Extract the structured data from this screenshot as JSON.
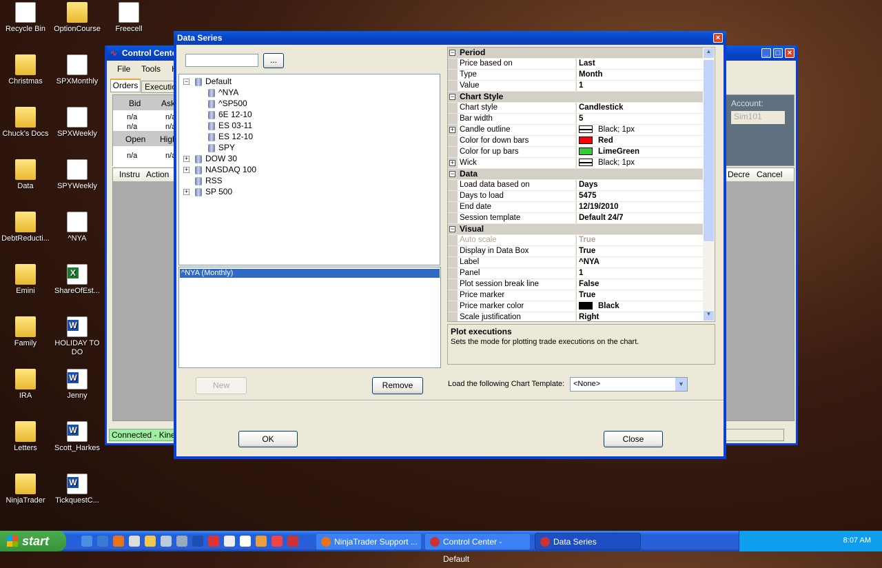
{
  "desktop": {
    "icons": [
      {
        "label": "Recycle Bin",
        "type": "recycle"
      },
      {
        "label": "OptionCourse",
        "type": "folder"
      },
      {
        "label": "Freecell",
        "type": "app"
      },
      {
        "label": "Christmas",
        "type": "folder"
      },
      {
        "label": "SPXMonthly",
        "type": "doc"
      },
      {
        "label": "Chuck's Docs",
        "type": "folder"
      },
      {
        "label": "SPXWeekly",
        "type": "doc"
      },
      {
        "label": "Data",
        "type": "folder"
      },
      {
        "label": "SPYWeekly",
        "type": "doc"
      },
      {
        "label": "DebtReducti...",
        "type": "folder"
      },
      {
        "label": "^NYA",
        "type": "doc"
      },
      {
        "label": "Emini",
        "type": "folder"
      },
      {
        "label": "ShareOfEst...",
        "type": "excel"
      },
      {
        "label": "Family",
        "type": "folder"
      },
      {
        "label": "HOLIDAY TO DO",
        "type": "word"
      },
      {
        "label": "IRA",
        "type": "folder"
      },
      {
        "label": "Jenny",
        "type": "word"
      },
      {
        "label": "Letters",
        "type": "folder"
      },
      {
        "label": "Scott_Harkes",
        "type": "word"
      },
      {
        "label": "NinjaTrader",
        "type": "folder"
      },
      {
        "label": "TickquestC...",
        "type": "word"
      }
    ]
  },
  "control_center": {
    "title": "Control Center",
    "menu": [
      "File",
      "Tools",
      "H"
    ],
    "tabs": [
      "Orders",
      "Execution"
    ],
    "quote_headers": [
      "Bid",
      "Ask"
    ],
    "quote_rows": [
      [
        "n/a",
        "n/a"
      ],
      [
        "n/a",
        "n/a"
      ]
    ],
    "ohlc_headers": [
      "Open",
      "High"
    ],
    "ohlc_row": [
      "n/a",
      "n/a"
    ],
    "account_label": "Account:",
    "account_value": "Sim101",
    "grid_headers": [
      "Instru",
      "Action"
    ],
    "grid_headers_right": [
      "Decre",
      "Cancel"
    ],
    "status": "Connected - Kinetic"
  },
  "dialog": {
    "title": "Data Series",
    "search_value": "",
    "browse_label": "...",
    "tree": [
      {
        "label": "Default",
        "expanded": true,
        "children": [
          "^NYA",
          "^SP500",
          "6E 12-10",
          "ES 03-11",
          "ES 12-10",
          "SPY"
        ]
      },
      {
        "label": "DOW 30",
        "expanded": false
      },
      {
        "label": "NASDAQ 100",
        "expanded": false
      },
      {
        "label": "RSS",
        "expanded": null
      },
      {
        "label": "SP 500",
        "expanded": false
      }
    ],
    "selected_series": [
      "^NYA (Monthly)"
    ],
    "new_label": "New",
    "remove_label": "Remove",
    "properties": [
      {
        "category": "Period",
        "rows": [
          {
            "name": "Price based on",
            "value": "Last"
          },
          {
            "name": "Type",
            "value": "Month"
          },
          {
            "name": "Value",
            "value": "1"
          }
        ]
      },
      {
        "category": "Chart Style",
        "rows": [
          {
            "name": "Chart style",
            "value": "Candlestick"
          },
          {
            "name": "Bar width",
            "value": "5"
          },
          {
            "name": "Candle outline",
            "value": "Black; 1px",
            "swatch": "line",
            "expandable": true
          },
          {
            "name": "Color for down bars",
            "value": "Red",
            "swatch": "#ff0000"
          },
          {
            "name": "Color for up bars",
            "value": "LimeGreen",
            "swatch": "#32cd32"
          },
          {
            "name": "Wick",
            "value": "Black; 1px",
            "swatch": "line",
            "expandable": true
          }
        ]
      },
      {
        "category": "Data",
        "rows": [
          {
            "name": "Load data based on",
            "value": "Days"
          },
          {
            "name": "Days to load",
            "value": "5475"
          },
          {
            "name": "End date",
            "value": "12/19/2010"
          },
          {
            "name": "Session template",
            "value": "Default 24/7"
          }
        ]
      },
      {
        "category": "Visual",
        "rows": [
          {
            "name": "Auto scale",
            "value": "True",
            "disabled": true
          },
          {
            "name": "Display in Data Box",
            "value": "True"
          },
          {
            "name": "Label",
            "value": "^NYA"
          },
          {
            "name": "Panel",
            "value": "1"
          },
          {
            "name": "Plot session break line",
            "value": "False"
          },
          {
            "name": "Price marker",
            "value": "True"
          },
          {
            "name": "Price marker color",
            "value": "Black",
            "swatch": "#000000"
          },
          {
            "name": "Scale justification",
            "value": "Right"
          }
        ]
      }
    ],
    "description_title": "Plot executions",
    "description_text": "Sets the mode for plotting trade executions on the chart.",
    "template_label": "Load the following Chart Template:",
    "template_value": "<None>",
    "ok_label": "OK",
    "close_label": "Close"
  },
  "taskbar": {
    "start_label": "start",
    "tasks": [
      {
        "label": "NinjaTrader Support ...",
        "active": false
      },
      {
        "label": "Control Center - Default",
        "active": false
      },
      {
        "label": "Data Series",
        "active": true
      }
    ],
    "clock": "8:07 AM"
  }
}
